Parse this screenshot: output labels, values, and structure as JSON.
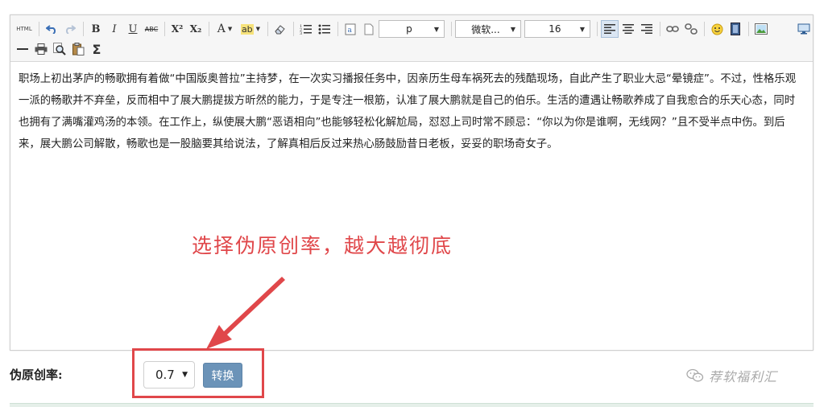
{
  "toolbar": {
    "html_label": "HTML",
    "bold_label": "B",
    "italic_label": "I",
    "underline_label": "U",
    "strike_label": "ABC",
    "superscript_label": "X²",
    "subscript_label": "X₂",
    "font_color_label": "A",
    "highlight_label": "ab",
    "sum_label": "Σ",
    "paragraph_select": "p",
    "font_family_select": "微软...",
    "font_size_select": "16"
  },
  "content": {
    "paragraph": "职场上初出茅庐的畅歌拥有着做“中国版奥普拉”主持梦，在一次实习播报任务中，因亲历生母车祸死去的残酷现场，自此产生了职业大忌“晕镜症”。不过，性格乐观一派的畅歌并不弃垒，反而相中了展大鹏提拔方昕然的能力，于是专注一根筋，认准了展大鹏就是自己的伯乐。生活的遭遇让畅歌养成了自我愈合的乐天心态，同时也拥有了满嘴灌鸡汤的本领。在工作上，纵使展大鹏“恶语相向”也能够轻松化解尬局，怼怼上司时常不顾忌：“你以为你是谁啊，无线网？”且不受半点中伤。到后来，展大鹏公司解散，畅歌也是一股脑要其给说法，了解真相后反过来热心肠鼓励昔日老板，妥妥的职场奇女子。"
  },
  "annotation": {
    "text": "选择伪原创率，越大越彻底",
    "color": "#e0474a"
  },
  "controls": {
    "rate_label": "伪原创率:",
    "rate_value": "0.7",
    "convert_label": "转换",
    "button_color": "#6b93b8"
  },
  "watermark": {
    "text": "荐软福利汇"
  }
}
